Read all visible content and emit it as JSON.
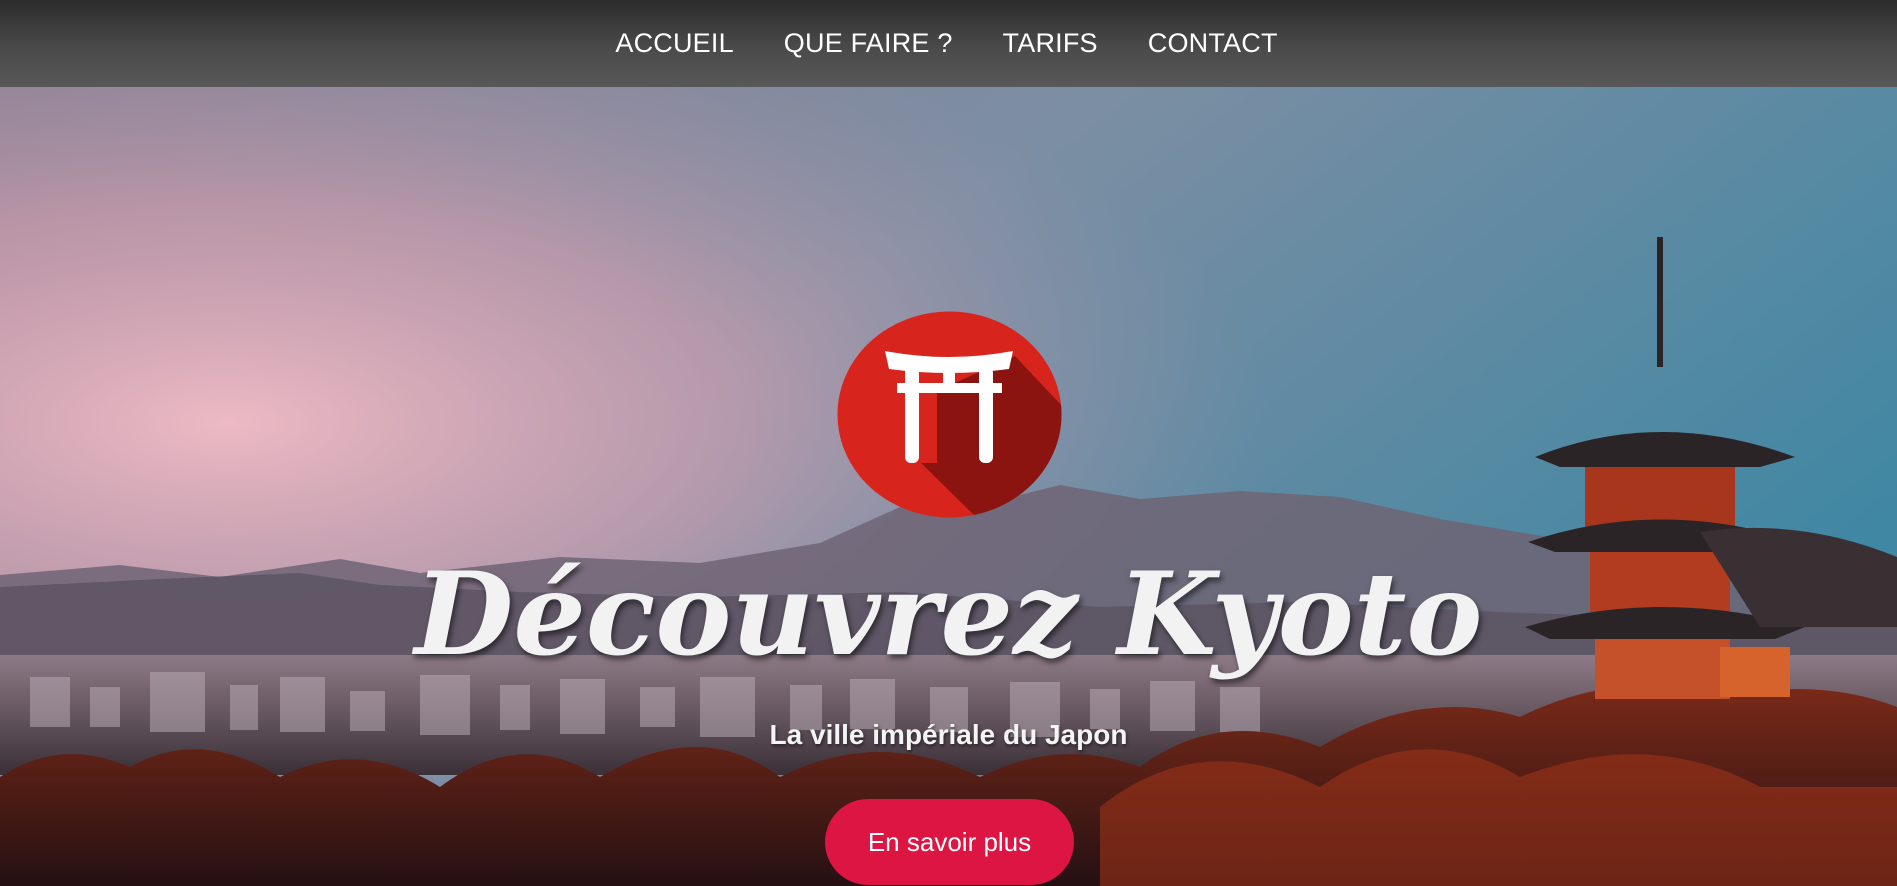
{
  "nav": {
    "items": [
      {
        "label": "ACCUEIL"
      },
      {
        "label": "QUE FAIRE ?"
      },
      {
        "label": "TARIFS"
      },
      {
        "label": "CONTACT"
      }
    ]
  },
  "hero": {
    "logo_icon": "torii-gate-icon",
    "title": "Découvrez Kyoto",
    "subtitle": "La ville impériale du Japon",
    "button_label": "En savoir plus"
  },
  "colors": {
    "accent": "#dc1543",
    "logo_red": "#d7241c",
    "navbar": "#4a4a4a"
  }
}
